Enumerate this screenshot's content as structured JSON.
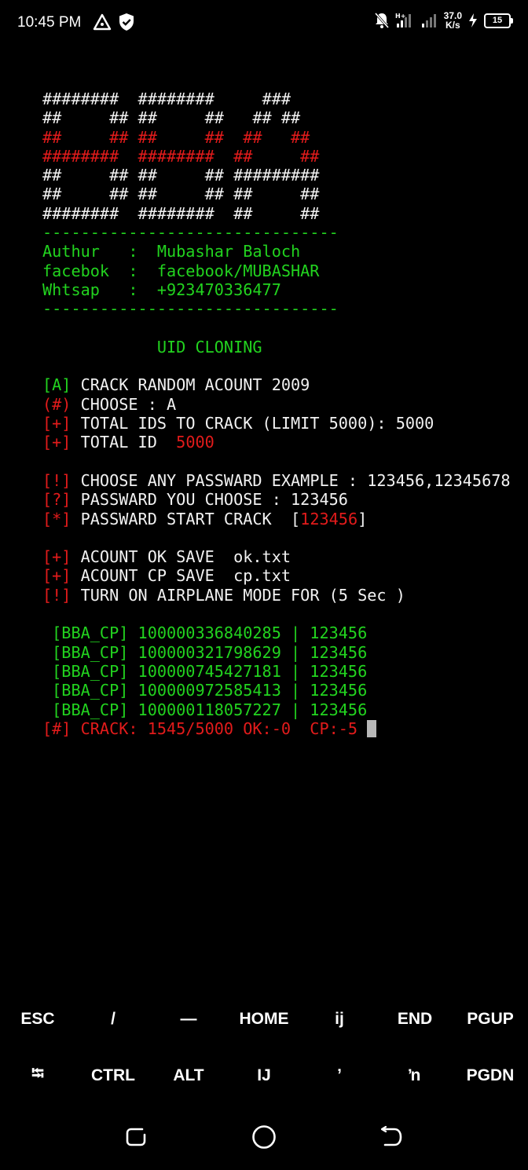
{
  "status_bar": {
    "time": "10:45 PM",
    "net_speed_value": "37.0",
    "net_speed_unit": "K/s",
    "battery_level": "15",
    "icons": [
      "alert-triangle-icon",
      "shield-check-icon",
      "bell-off-icon",
      "signal-icon",
      "signal-weak-icon",
      "charging-bolt-icon",
      "battery-icon"
    ]
  },
  "terminal": {
    "lines": [
      [
        {
          "t": "########  ########     ###",
          "c": "w"
        }
      ],
      [
        {
          "t": "##     ## ##     ##   ## ##",
          "c": "w"
        }
      ],
      [
        {
          "t": "##     ## ##     ##  ##   ##",
          "c": "r"
        }
      ],
      [
        {
          "t": "########  ########  ##     ##",
          "c": "r"
        }
      ],
      [
        {
          "t": "##     ## ##     ## #########",
          "c": "w"
        }
      ],
      [
        {
          "t": "##     ## ##     ## ##     ##",
          "c": "w"
        }
      ],
      [
        {
          "t": "########  ########  ##     ##",
          "c": "w"
        }
      ],
      [
        {
          "t": "-------------------------------",
          "c": "g"
        }
      ],
      [
        {
          "t": "Authur   :  Mubashar Baloch",
          "c": "g"
        }
      ],
      [
        {
          "t": "facebok  :  facebook/MUBASHAR",
          "c": "g"
        }
      ],
      [
        {
          "t": "Whtsap   :  +923470336477",
          "c": "g"
        }
      ],
      [
        {
          "t": "-------------------------------",
          "c": "g"
        }
      ],
      [
        {
          "t": "",
          "c": "w"
        }
      ],
      [
        {
          "t": "            UID CLONING",
          "c": "g"
        }
      ],
      [
        {
          "t": "",
          "c": "w"
        }
      ],
      [
        {
          "t": "[A]",
          "c": "g"
        },
        {
          "t": " CRACK RANDOM ACOUNT 2009",
          "c": "w"
        }
      ],
      [
        {
          "t": "(#)",
          "c": "r"
        },
        {
          "t": " CHOOSE : A",
          "c": "w"
        }
      ],
      [
        {
          "t": "[+]",
          "c": "r"
        },
        {
          "t": " TOTAL IDS TO CRACK (LIMIT 5000): 5000",
          "c": "w"
        }
      ],
      [
        {
          "t": "[+]",
          "c": "r"
        },
        {
          "t": " TOTAL ID  ",
          "c": "w"
        },
        {
          "t": "5000",
          "c": "r"
        }
      ],
      [
        {
          "t": "",
          "c": "w"
        }
      ],
      [
        {
          "t": "[!]",
          "c": "r"
        },
        {
          "t": " CHOOSE ANY PASSWARD EXAMPLE : 123456,12345678",
          "c": "w"
        }
      ],
      [
        {
          "t": "[?]",
          "c": "r"
        },
        {
          "t": " PASSWARD YOU CHOOSE : 123456",
          "c": "w"
        }
      ],
      [
        {
          "t": "[*]",
          "c": "r"
        },
        {
          "t": " PASSWARD START CRACK  [",
          "c": "w"
        },
        {
          "t": "123456",
          "c": "r"
        },
        {
          "t": "]",
          "c": "w"
        }
      ],
      [
        {
          "t": "",
          "c": "w"
        }
      ],
      [
        {
          "t": "[+]",
          "c": "r"
        },
        {
          "t": " ACOUNT OK SAVE  ok.txt",
          "c": "w"
        }
      ],
      [
        {
          "t": "[+]",
          "c": "r"
        },
        {
          "t": " ACOUNT CP SAVE  cp.txt",
          "c": "w"
        }
      ],
      [
        {
          "t": "[!]",
          "c": "r"
        },
        {
          "t": " TURN ON AIRPLANE MODE FOR (5 Sec )",
          "c": "w"
        }
      ],
      [
        {
          "t": "",
          "c": "w"
        }
      ],
      [
        {
          "t": " [BBA_CP] 100000336840285 | 123456",
          "c": "g"
        }
      ],
      [
        {
          "t": " [BBA_CP] 100000321798629 | 123456",
          "c": "g"
        }
      ],
      [
        {
          "t": " [BBA_CP] 100000745427181 | 123456",
          "c": "g"
        }
      ],
      [
        {
          "t": " [BBA_CP] 100000972585413 | 123456",
          "c": "g"
        }
      ],
      [
        {
          "t": " [BBA_CP] 100000118057227 | 123456",
          "c": "g"
        }
      ],
      [
        {
          "t": "[#] CRACK: 1545/5000 OK:-0  CP:-5 ",
          "c": "r"
        }
      ]
    ],
    "colors": {
      "w": "#f2f2f2",
      "g": "#22d31f",
      "r": "#e21b1b"
    }
  },
  "extra_keys": {
    "row1": [
      {
        "label": "ESC",
        "name": "esc-key"
      },
      {
        "label": "/",
        "name": "slash-key"
      },
      {
        "label": "—",
        "name": "dash-key"
      },
      {
        "label": "HOME",
        "name": "home-key"
      },
      {
        "label": "ij",
        "name": "ij-key"
      },
      {
        "label": "END",
        "name": "end-key"
      },
      {
        "label": "PGUP",
        "name": "pgup-key"
      }
    ],
    "row2": [
      {
        "label": "⭾",
        "name": "tab-key"
      },
      {
        "label": "CTRL",
        "name": "ctrl-key"
      },
      {
        "label": "ALT",
        "name": "alt-key"
      },
      {
        "label": "IJ",
        "name": "capital-ij-key"
      },
      {
        "label": "ʼ",
        "name": "apostrophe-key"
      },
      {
        "label": "ŉ",
        "name": "n-apostrophe-key"
      },
      {
        "label": "PGDN",
        "name": "pgdn-key"
      }
    ]
  },
  "nav_bar": {
    "buttons": [
      "recent-apps-icon",
      "home-circle-icon",
      "back-icon"
    ]
  }
}
